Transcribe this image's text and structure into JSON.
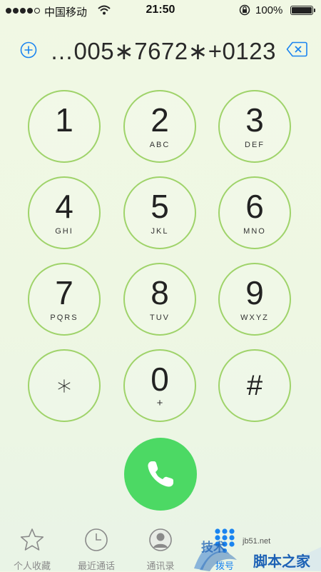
{
  "status_bar": {
    "signal_bars_filled": 4,
    "carrier": "中国移动",
    "time": "21:50",
    "battery_percent": "100%",
    "orientation_lock_icon": "orientation-lock-icon",
    "wifi_icon": "wifi-icon"
  },
  "dialer": {
    "entered_number": "…005∗7672∗+0123",
    "add_contact_icon": "plus-circle-icon",
    "delete_icon": "backspace-icon"
  },
  "keypad": [
    {
      "digit": "1",
      "letters": ""
    },
    {
      "digit": "2",
      "letters": "ABC"
    },
    {
      "digit": "3",
      "letters": "DEF"
    },
    {
      "digit": "4",
      "letters": "GHI"
    },
    {
      "digit": "5",
      "letters": "JKL"
    },
    {
      "digit": "6",
      "letters": "MNO"
    },
    {
      "digit": "7",
      "letters": "PQRS"
    },
    {
      "digit": "8",
      "letters": "TUV"
    },
    {
      "digit": "9",
      "letters": "WXYZ"
    },
    {
      "digit": "∗",
      "letters": ""
    },
    {
      "digit": "0",
      "letters": "+"
    },
    {
      "digit": "#",
      "letters": ""
    }
  ],
  "call_button": {
    "icon": "phone-icon",
    "color": "#4cd964"
  },
  "tabbar": {
    "active_color": "#1a84f0",
    "tabs": [
      {
        "label": "个人收藏",
        "icon": "star-icon"
      },
      {
        "label": "最近通话",
        "icon": "clock-icon"
      },
      {
        "label": "通讯录",
        "icon": "contacts-icon"
      },
      {
        "label": "拨号",
        "icon": "keypad-icon",
        "active": true
      }
    ]
  },
  "watermark": {
    "brand": "脚本之家",
    "tech_text": "技术",
    "url": "jb51.net"
  },
  "colors": {
    "key_ring": "#9fd36a",
    "call_green": "#4cd964",
    "accent_blue": "#1a84f0"
  }
}
